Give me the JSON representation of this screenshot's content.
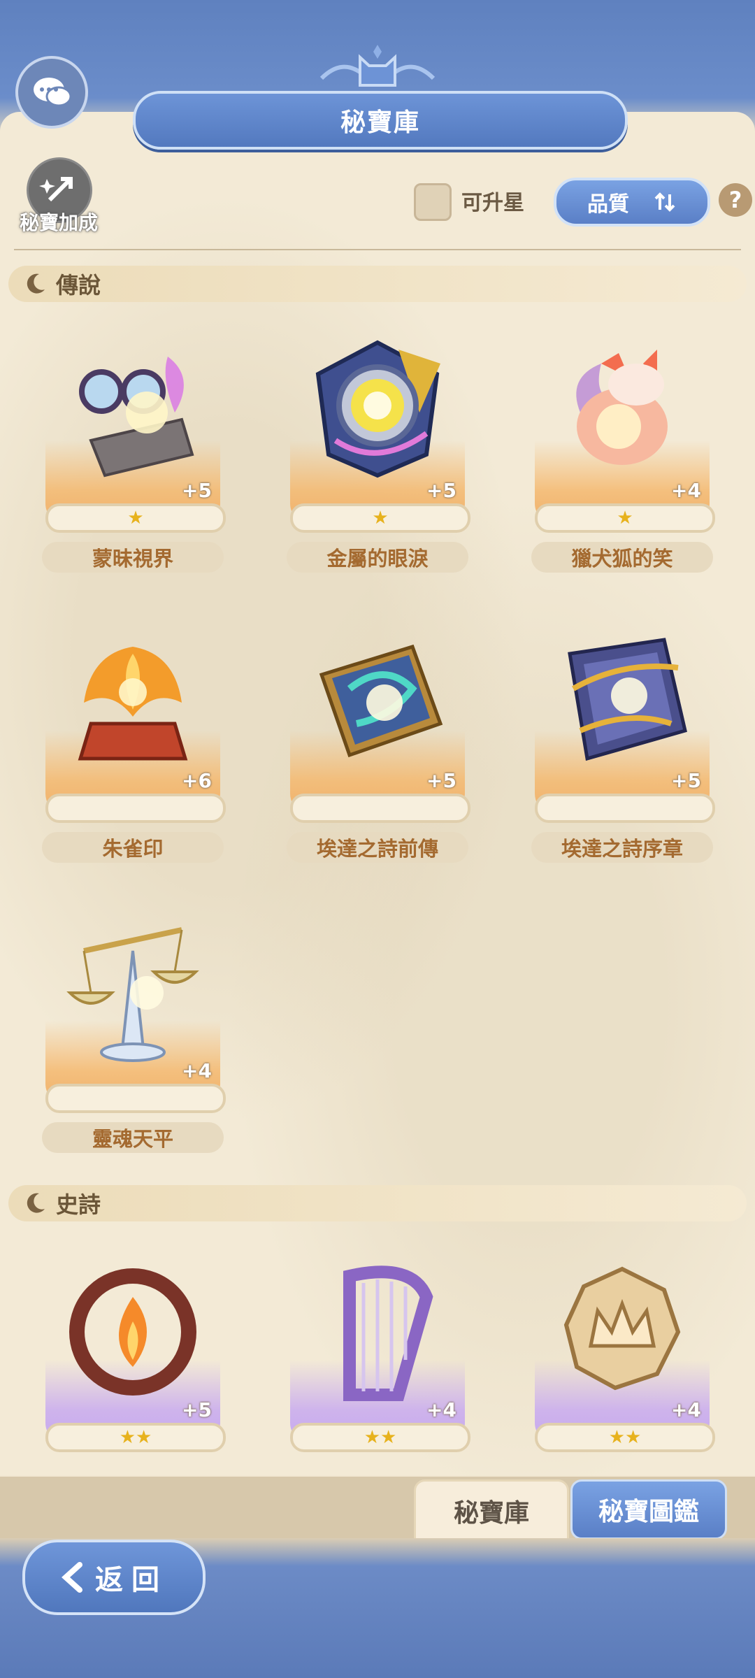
{
  "header": {
    "title": "秘寶庫"
  },
  "toolbar": {
    "bonus_label": "秘寶加成",
    "upgradeable_label": "可升星",
    "sort_label": "品質",
    "help_label": "?"
  },
  "sections": [
    {
      "title": "傳說",
      "items": [
        {
          "name": "蒙昧視界",
          "level": "+5",
          "stars": "★"
        },
        {
          "name": "金屬的眼淚",
          "level": "+5",
          "stars": "★"
        },
        {
          "name": "獵犬狐的笑",
          "level": "+4",
          "stars": "★"
        },
        {
          "name": "朱雀印",
          "level": "+6",
          "stars": ""
        },
        {
          "name": "埃達之詩前傳",
          "level": "+5",
          "stars": ""
        },
        {
          "name": "埃達之詩序章",
          "level": "+5",
          "stars": ""
        },
        {
          "name": "靈魂天平",
          "level": "+4",
          "stars": ""
        }
      ]
    },
    {
      "title": "史詩",
      "items": [
        {
          "name": "",
          "level": "+5",
          "stars": "★★"
        },
        {
          "name": "",
          "level": "+4",
          "stars": "★★"
        },
        {
          "name": "",
          "level": "+4",
          "stars": "★★"
        }
      ]
    }
  ],
  "tabs": {
    "vault": "秘寶庫",
    "codex": "秘寶圖鑑"
  },
  "nav": {
    "back_label": "返回"
  },
  "colors": {
    "accent_blue": "#5a7fc6",
    "legend_gold": "#f0b06a",
    "epic_purple": "#c6a8ef"
  }
}
